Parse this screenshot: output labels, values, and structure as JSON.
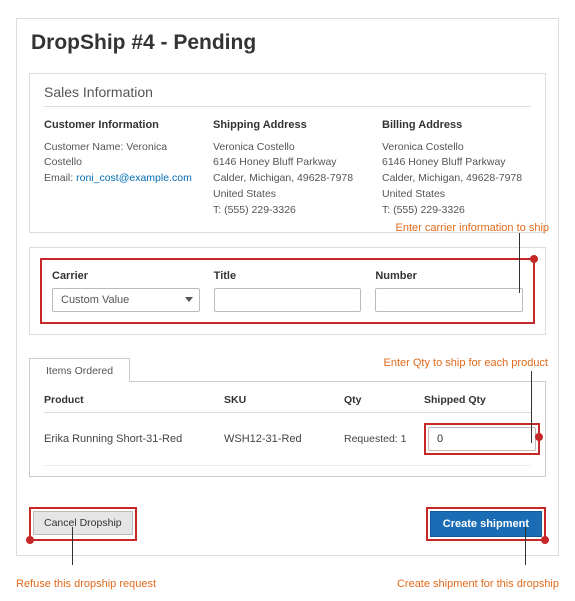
{
  "pageTitle": "DropShip #4 - Pending",
  "salesInfo": {
    "heading": "Sales Information",
    "customer": {
      "title": "Customer Information",
      "nameLabel": "Customer Name:",
      "name": "Veronica Costello",
      "emailLabel": "Email:",
      "email": "roni_cost@example.com"
    },
    "shipping": {
      "title": "Shipping Address",
      "name": "Veronica Costello",
      "line1": "6146 Honey Bluff Parkway",
      "line2": "Calder, Michigan, 49628-7978",
      "country": "United States",
      "phone": "T: (555) 229-3326"
    },
    "billing": {
      "title": "Billing Address",
      "name": "Veronica Costello",
      "line1": "6146 Honey Bluff Parkway",
      "line2": "Calder, Michigan, 49628-7978",
      "country": "United States",
      "phone": "T: (555) 229-3326"
    }
  },
  "annotations": {
    "carrier": "Enter carrier information to ship",
    "qty": "Enter Qty to ship for each product",
    "cancel": "Refuse this dropship request",
    "create": "Create shipment for this dropship"
  },
  "carrierForm": {
    "carrierLabel": "Carrier",
    "carrierValue": "Custom Value",
    "titleLabel": "Title",
    "titleValue": "",
    "numberLabel": "Number",
    "numberValue": ""
  },
  "items": {
    "tab": "Items Ordered",
    "headers": {
      "product": "Product",
      "sku": "SKU",
      "qty": "Qty",
      "shippedQty": "Shipped Qty"
    },
    "rows": [
      {
        "product": "Erika Running Short-31-Red",
        "sku": "WSH12-31-Red",
        "qty": "Requested: 1",
        "shippedQty": "0"
      }
    ]
  },
  "buttons": {
    "cancel": "Cancel Dropship",
    "create": "Create shipment"
  }
}
